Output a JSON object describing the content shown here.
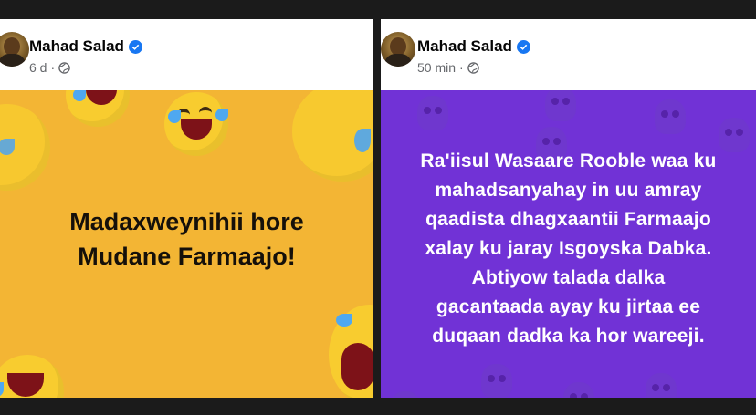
{
  "posts": [
    {
      "author": "Mahad Salad",
      "time": "6 d",
      "separator": "·",
      "privacy_icon": "globe-icon",
      "verified_icon": "verified-badge-icon",
      "background_color": "#f3b534",
      "text_color": "#15100a",
      "lines": [
        "Madaxweynihii hore",
        "Mudane Farmaajo!"
      ]
    },
    {
      "author": "Mahad Salad",
      "time": "50 min",
      "separator": "·",
      "privacy_icon": "globe-icon",
      "verified_icon": "verified-badge-icon",
      "background_color": "#7132d6",
      "text_color": "#ffffff",
      "lines": [
        "Ra'iisul Wasaare Rooble waa ku",
        "mahadsanyahay in uu amray",
        "qaadista dhagxaantii Farmaajo",
        "xalay ku jaray Isgoyska Dabka.",
        "Abtiyow talada dalka",
        "gacantaada ayay ku jirtaa ee",
        "duqaan dadka ka hor wareeji."
      ]
    }
  ]
}
